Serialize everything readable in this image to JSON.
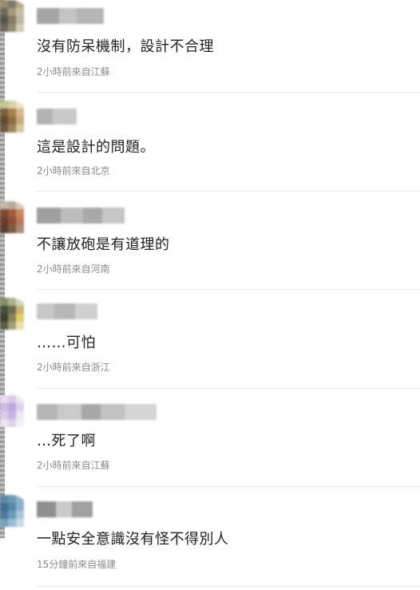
{
  "comments": [
    {
      "text": "沒有防呆機制，設計不合理",
      "meta": "2小時前來自江蘇"
    },
    {
      "text": "這是設計的問題。",
      "meta": "2小時前來自北京"
    },
    {
      "text": "不讓放砲是有道理的",
      "meta": "2小時前來自河南"
    },
    {
      "text": "……可怕",
      "meta": "2小時前來自浙江"
    },
    {
      "text": "…死了啊",
      "meta": "2小時前來自江蘇"
    },
    {
      "text": "一點安全意識沒有怪不得別人",
      "meta": "15分鐘前來自福建"
    }
  ]
}
